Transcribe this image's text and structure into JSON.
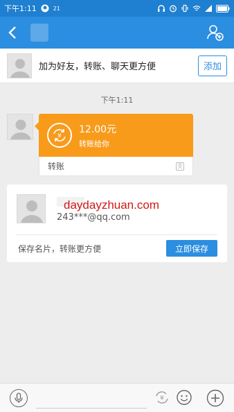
{
  "status_bar": {
    "time": "下午1:11",
    "notification_badge": "21"
  },
  "nav": {
    "back_icon": "back-arrow-icon",
    "add_contact_icon": "add-contact-icon"
  },
  "banner": {
    "text": "加为好友，转账、聊天更方便",
    "add_label": "添加"
  },
  "chat": {
    "timestamp": "下午1:11",
    "transfer": {
      "amount": "12.00元",
      "description": "转账给你",
      "footer_label": "转账",
      "accent_color": "#f89b1b"
    }
  },
  "contact_card": {
    "watermark": "daydayzhuan.com",
    "email": "243***@qq.com",
    "hint": "保存名片，转账更方便",
    "save_label": "立即保存"
  },
  "input_bar": {
    "placeholder": ""
  },
  "colors": {
    "brand": "#2b8ee0",
    "status_bar": "#1f7fd0",
    "background": "#ededed"
  }
}
